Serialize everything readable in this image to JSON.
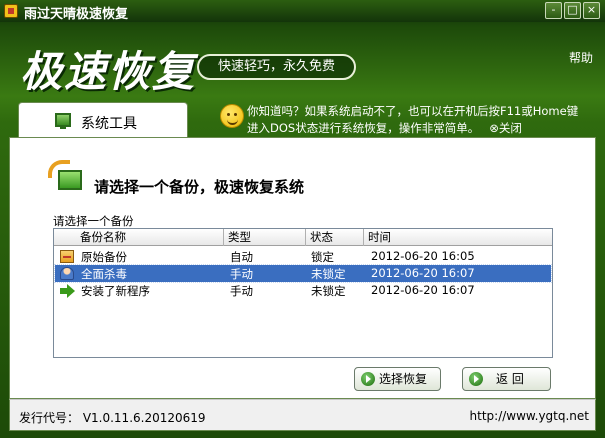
{
  "window": {
    "title": "雨过天晴极速恢复",
    "min_label": "-",
    "max_label": "□",
    "close_label": "×"
  },
  "header": {
    "logo_text": "极速恢复",
    "slogan": "快速轻巧，永久免费",
    "help_label": "帮助"
  },
  "tab": {
    "label": "系统工具"
  },
  "tip": {
    "line1": "你知道吗？如果系统启动不了，也可以在开机后按F11或Home键",
    "line2": "进入DOS状态进行系统恢复，操作非常简单。",
    "close_label": "⊗关闭"
  },
  "main": {
    "title": "请选择一个备份，极速恢复系统",
    "list_caption": "请选择一个备份"
  },
  "list": {
    "columns": [
      "备份名称",
      "类型",
      "状态",
      "时间"
    ],
    "rows": [
      {
        "name": "原始备份",
        "type": "自动",
        "status": "锁定",
        "time": "2012-06-20 16:05",
        "icon": "disk-icon"
      },
      {
        "name": "全面杀毒",
        "type": "手动",
        "status": "未锁定",
        "time": "2012-06-20 16:07",
        "icon": "user-icon"
      },
      {
        "name": "安装了新程序",
        "type": "手动",
        "status": "未锁定",
        "time": "2012-06-20 16:07",
        "icon": "arrow-right-icon"
      }
    ],
    "selected_index": 1
  },
  "buttons": {
    "restore_label": "选择恢复",
    "back_label": "返 回"
  },
  "footer": {
    "version": "发行代号： V1.0.11.6.20120619",
    "url": "http://www.ygtq.net"
  },
  "colors": {
    "accent_green": "#3a7a12",
    "selection": "#3a6ec0"
  }
}
